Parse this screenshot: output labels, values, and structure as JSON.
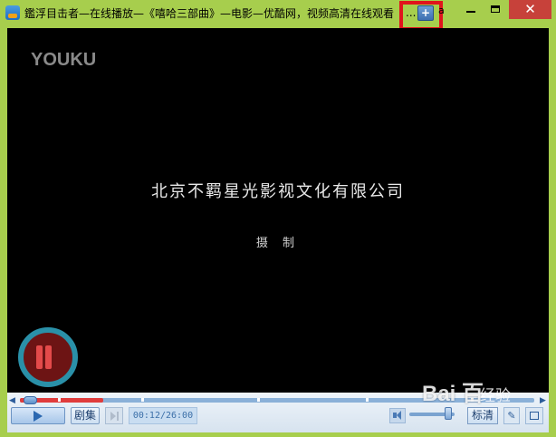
{
  "window": {
    "title": "鑑浮目击者—在线播放—《嘻哈三部曲》—电影—优酷网，视频高清在线观看",
    "title_ellipsis": "...",
    "pin_glyph": "+",
    "small_glyph": "a",
    "controls": {
      "close_glyph": "✕"
    },
    "accent_colors": {
      "frame": "#a7ce4d",
      "highlight": "#e0141c",
      "close": "#c7413a"
    }
  },
  "video": {
    "logo": "YOUKU",
    "credit_company": "北京不羁星光影视文化有限公司",
    "credit_role": "摄 制"
  },
  "player": {
    "episodes_label": "剧集",
    "time_display": "00:12/26:00",
    "quality_label": "标清",
    "seek_left_glyph": "◀",
    "seek_right_glyph": "▶",
    "settings_glyph": "✎",
    "progress_fraction": 0.0077,
    "volume_fraction": 0.85
  },
  "watermark": {
    "brand": "Bai 百",
    "sub": "经验"
  }
}
